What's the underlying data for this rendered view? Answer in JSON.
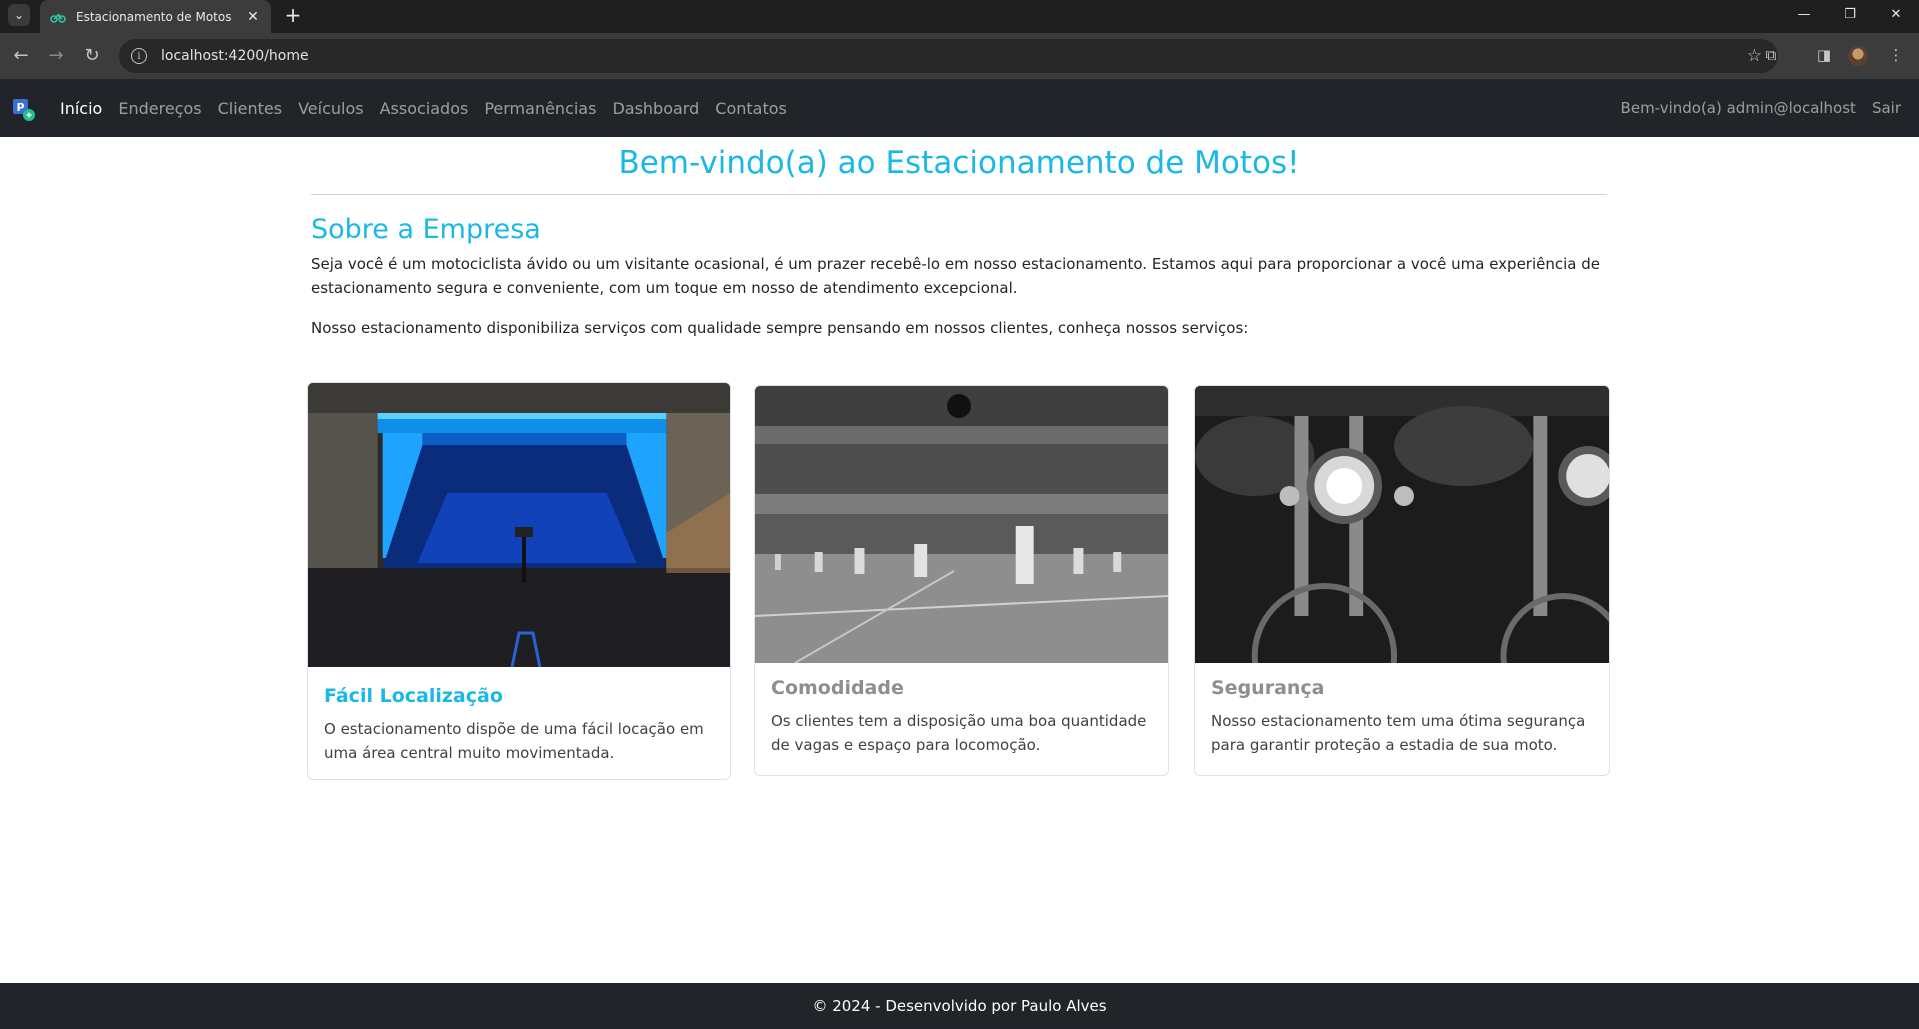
{
  "browser": {
    "tab_title": "Estacionamento de Motos",
    "url": "localhost:4200/home"
  },
  "navbar": {
    "links": [
      {
        "label": "Início",
        "active": true
      },
      {
        "label": "Endereços",
        "active": false
      },
      {
        "label": "Clientes",
        "active": false
      },
      {
        "label": "Veículos",
        "active": false
      },
      {
        "label": "Associados",
        "active": false
      },
      {
        "label": "Permanências",
        "active": false
      },
      {
        "label": "Dashboard",
        "active": false
      },
      {
        "label": "Contatos",
        "active": false
      }
    ],
    "welcome": "Bem-vindo(a) admin@localhost",
    "logout": "Sair"
  },
  "main": {
    "title": "Bem-vindo(a) ao Estacionamento de Motos!",
    "about_title": "Sobre a Empresa",
    "about_text": "Seja você é um motociclista ávido ou um visitante ocasional, é um prazer recebê-lo em nosso estacionamento. Estamos aqui para proporcionar a você uma experiência de estacionamento segura e conveniente, com um toque em nosso de atendimento excepcional.",
    "services_intro": "Nosso estacionamento disponibiliza serviços com qualidade sempre pensando em nossos clientes, conheça nossos serviços:"
  },
  "cards": [
    {
      "title": "Fácil Localização",
      "text": "O estacionamento dispõe de uma fácil locação em uma área central muito movimentada."
    },
    {
      "title": "Comodidade",
      "text": "Os clientes tem a disposição uma boa quantidade de vagas e espaço para locomoção."
    },
    {
      "title": "Segurança",
      "text": "Nosso estacionamento tem uma ótima segurança para garantir proteção a estadia de sua moto."
    }
  ],
  "footer": {
    "text": "© 2024 - Desenvolvido por Paulo Alves"
  },
  "colors": {
    "accent": "#1bb8e6",
    "navbar_bg": "#212529",
    "footer_bg": "#212529"
  }
}
